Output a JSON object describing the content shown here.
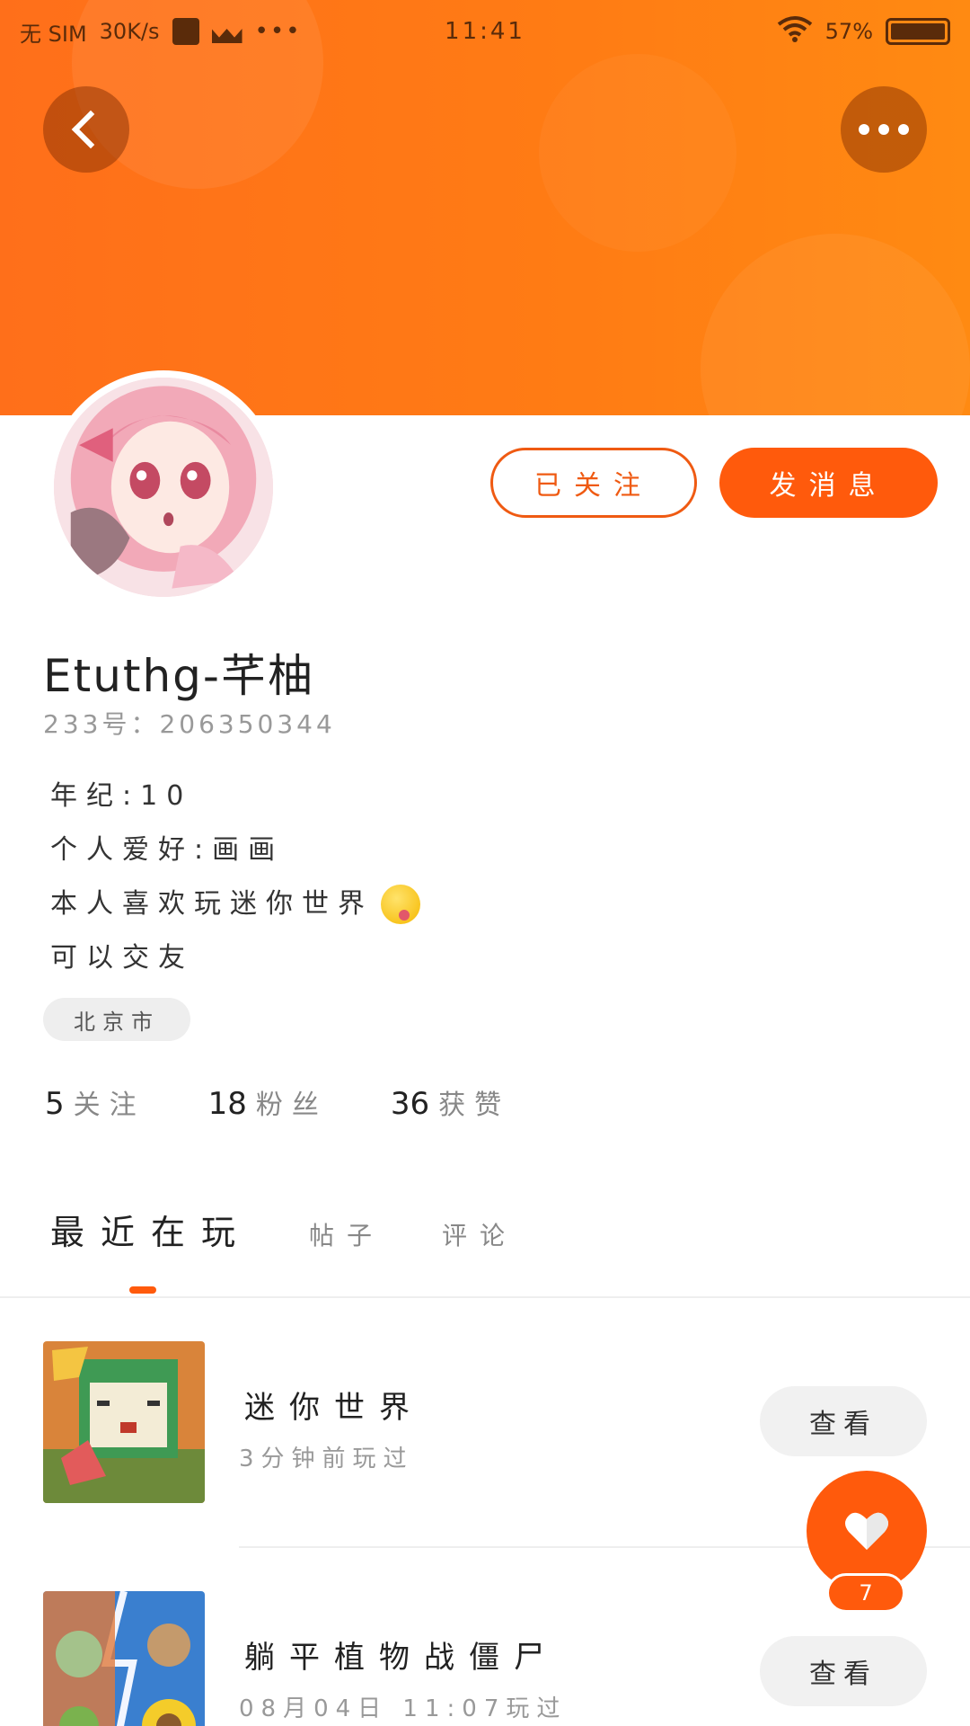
{
  "status_bar": {
    "carrier": "无 SIM",
    "speed": "30K/s",
    "time": "11:41",
    "battery": "57%"
  },
  "header": {
    "colors": {
      "accent": "#ff5a0c",
      "banner": "#ff7c14"
    }
  },
  "profile": {
    "follow_button": "已关注",
    "message_button": "发消息",
    "name": "Etuthg-芊柚",
    "id_label": "233号：206350344",
    "bio": [
      "年纪:10",
      "个人爱好:画画",
      "本人喜欢玩迷你世界",
      "可以交友"
    ],
    "emoji": "winking-tongue-emoji",
    "location": "北京市"
  },
  "stats": [
    {
      "value": "5",
      "label": "关注"
    },
    {
      "value": "18",
      "label": "粉丝"
    },
    {
      "value": "36",
      "label": "获赞"
    }
  ],
  "tabs": [
    {
      "label": "最近在玩",
      "active": true
    },
    {
      "label": "帖子",
      "active": false
    },
    {
      "label": "评论",
      "active": false
    }
  ],
  "games": [
    {
      "title": "迷你世界",
      "subtitle": "3分钟前玩过",
      "action": "查看"
    },
    {
      "title": "躺平植物战僵尸",
      "subtitle": "08月04日 11:07玩过",
      "action": "查看"
    }
  ],
  "like": {
    "count": "7"
  }
}
